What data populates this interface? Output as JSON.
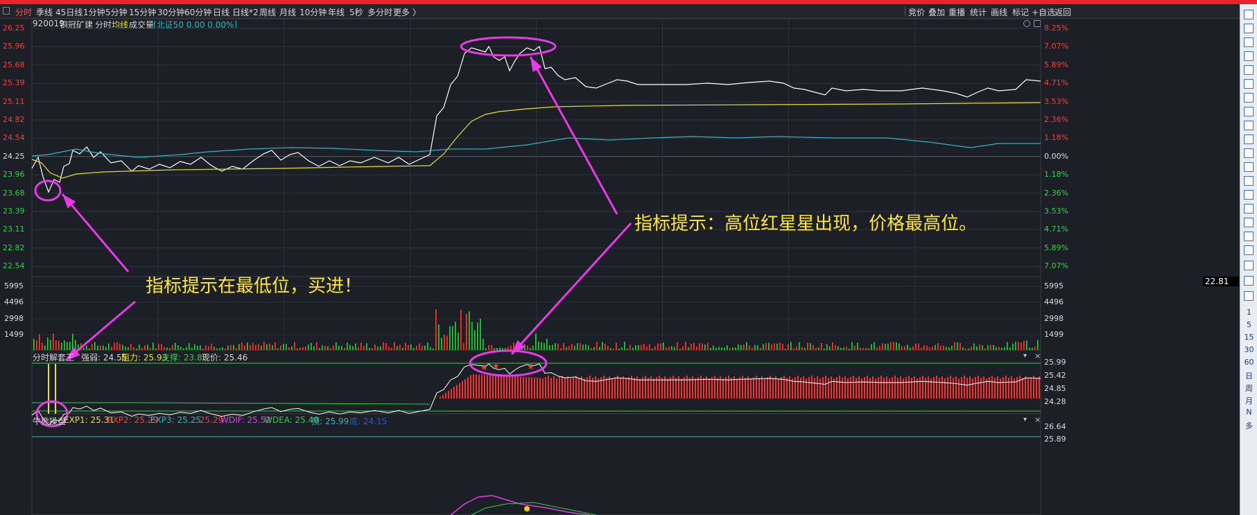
{
  "tabs": [
    "分时",
    "季线",
    "45日线",
    "1分钟",
    "5分钟",
    "15分钟",
    "30分钟",
    "60分钟",
    "日线",
    "日线*2",
    "周线",
    "月线",
    "10分钟",
    "年线",
    "5秒",
    "多分时",
    "更多 〉"
  ],
  "right_tools": [
    "竞价",
    "叠加",
    "重播",
    "统计",
    "画线",
    "标记",
    "+自选",
    "返回"
  ],
  "header": {
    "code": "920019",
    "name": "铜冠矿建",
    "mode": "分时",
    "avg": "均线",
    "vol": "成交量",
    "index_info": "[北证50 0.00 0.00%]"
  },
  "price_axis_left": [
    "26.25",
    "25.96",
    "25.68",
    "25.39",
    "25.11",
    "24.82",
    "24.54",
    "24.25",
    "23.96",
    "23.68",
    "23.39",
    "23.11",
    "22.82",
    "22.54"
  ],
  "pct_axis_right": [
    "8.25%",
    "7.07%",
    "5.89%",
    "4.71%",
    "3.53%",
    "2.36%",
    "1.18%",
    "0.00%",
    "1.18%",
    "2.36%",
    "3.53%",
    "4.71%",
    "5.89%",
    "7.07%"
  ],
  "current_price_box": "22.81",
  "volume_axis": [
    "5995",
    "4496",
    "2998",
    "1499"
  ],
  "ind1": {
    "name": "分时解套王",
    "qr": "强弱: 24.55",
    "zl": "阻力: 25.93",
    "zc": "支撑: 23.87",
    "xj": "现价: 25.46",
    "axis": [
      "25.99",
      "25.42",
      "24.85",
      "24.28"
    ]
  },
  "ind2": {
    "name": "牛熊操盘",
    "exp1": "EXP1: 25.31",
    "exp2": "EXP2: 25.29",
    "exp3": "EXP3: 25.25",
    "e4": ": 25.29",
    "wdif": "WDIF: 25.52",
    "wdea": "WDEA: 25.40",
    "top": "顶: 25.99",
    "bottom": "底: 24.15",
    "axis": [
      "26.64",
      "25.89"
    ]
  },
  "annotations": {
    "buy": "指标提示在最低位，买进！",
    "sell": "指标提示：高位红星星出现，价格最高位。"
  },
  "right_sidebar_texts": [
    "1",
    "5",
    "15",
    "30",
    "60",
    "日",
    "周",
    "月",
    "N",
    "多"
  ],
  "colors": {
    "up": "#ff3b3b",
    "down": "#2fd04a",
    "price": "#ffffff",
    "avg": "#e5e02a",
    "cyan": "#2ab8c4",
    "magenta": "#e83ae8",
    "yellow": "#ffe82a"
  }
}
